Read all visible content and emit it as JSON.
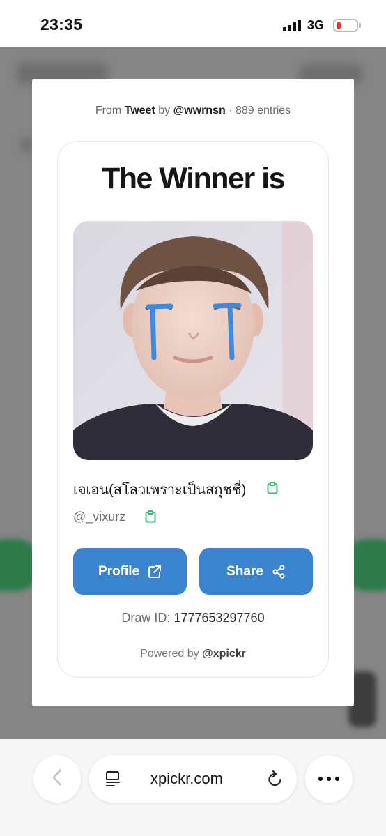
{
  "status_bar": {
    "time": "23:35",
    "network": "3G"
  },
  "modal": {
    "source": {
      "prefix": "From",
      "platform": "Tweet",
      "by": "by",
      "author": "@wwrnsn",
      "separator": "·",
      "entries": "889 entries"
    },
    "heading": "The Winner is",
    "winner": {
      "name": "เจเอน(สโลวเพราะเป็นสกุชชี่)",
      "handle": "@_vixurz"
    },
    "buttons": {
      "profile_label": "Profile",
      "share_label": "Share"
    },
    "draw": {
      "label": "Draw ID:",
      "id": "1777653297760"
    },
    "powered": {
      "label": "Powered by",
      "brand": "@xpickr"
    }
  },
  "browser": {
    "url": "xpickr.com"
  },
  "icons": [
    "copy-icon",
    "external-link-icon",
    "share-icon",
    "back-arrow-icon",
    "reader-icon",
    "reload-icon",
    "more-icon"
  ],
  "colors": {
    "accent": "#3a84cf",
    "copy_icon": "#3dbb6e",
    "battery_low": "#e5332a"
  }
}
